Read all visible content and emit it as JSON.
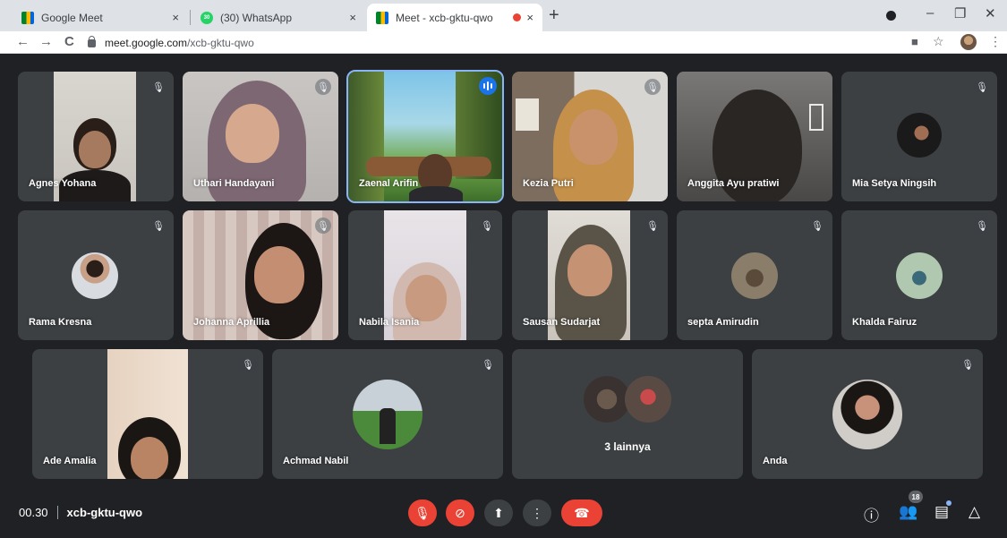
{
  "tabs": [
    {
      "title": "Google Meet",
      "close": "×"
    },
    {
      "title": "(30) WhatsApp",
      "badge": "30",
      "close": "×"
    },
    {
      "title": "Meet - xcb-gktu-qwo",
      "close": "×"
    }
  ],
  "new_tab": "+",
  "window_controls": {
    "minimize": "–",
    "restore": "❐",
    "close": "✕"
  },
  "address": {
    "host": "meet.google.com",
    "path": "/xcb-gktu-qwo"
  },
  "nav": {
    "back": "←",
    "forward": "→",
    "reload": "C"
  },
  "icons": {
    "mute": "mic-off-icon",
    "camera": "camera-icon",
    "star": "star-icon",
    "menu": "kebab-menu-icon"
  },
  "participants": [
    {
      "name": "Agnes Yohana"
    },
    {
      "name": "Uthari Handayani"
    },
    {
      "name": "Zaenal Arifin",
      "speaking": true
    },
    {
      "name": "Kezia Putri"
    },
    {
      "name": "Anggita Ayu pratiwi"
    },
    {
      "name": "Mia Setya Ningsih"
    },
    {
      "name": "Rama Kresna"
    },
    {
      "name": "Johanna Aprillia"
    },
    {
      "name": "Nabila Isania"
    },
    {
      "name": "Sausan Sudarjat"
    },
    {
      "name": "septa Amirudin"
    },
    {
      "name": "Khalda Fairuz"
    },
    {
      "name": "Ade Amalia"
    },
    {
      "name": "Achmad Nabil"
    },
    {
      "name": "3 lainnya"
    },
    {
      "name": "Anda"
    }
  ],
  "bottom": {
    "time": "00.30",
    "meeting_code": "xcb-gktu-qwo",
    "people_count": "18"
  },
  "colors": {
    "end_call": "#ea4335",
    "speaking_outline": "#8ab4f8",
    "tile_bg": "#3c4043",
    "bar_bg": "#202124"
  }
}
